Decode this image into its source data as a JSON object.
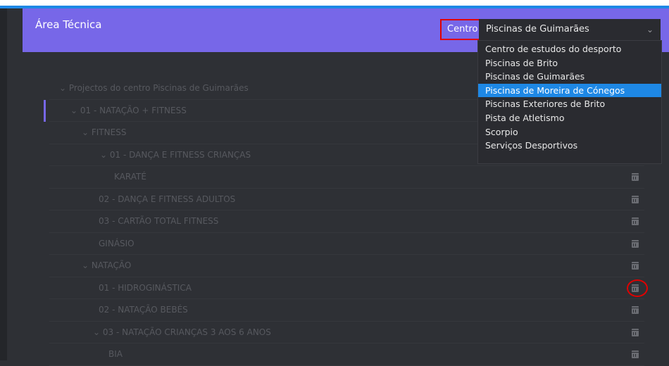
{
  "header": {
    "title": "Área Técnica",
    "centro_label": "Centro",
    "select_value": "Piscinas de Guimarães"
  },
  "dropdown": {
    "options": [
      "Centro de estudos do desporto",
      "Piscinas de Brito",
      "Piscinas de Guimarães",
      "Piscinas de Moreira de Cónegos",
      "Piscinas Exteriores de Brito",
      "Pista de Atletismo",
      "Scorpio",
      "Serviços Desportivos"
    ],
    "highlighted": "Piscinas de Moreira de Cónegos"
  },
  "tree": {
    "rows": [
      {
        "label": "⌄ Projectos do centro Piscinas de Guimarães",
        "calendar": false
      },
      {
        "label": "⌄ 01 - NATAÇÃO + FITNESS",
        "calendar": false
      },
      {
        "label": "⌄ FITNESS",
        "calendar": false
      },
      {
        "label": "⌄ 01 - DANÇA E FITNESS CRIANÇAS",
        "calendar": false
      },
      {
        "label": "KARATÉ",
        "calendar": true
      },
      {
        "label": "02 - DANÇA E FITNESS ADULTOS",
        "calendar": true
      },
      {
        "label": "03 - CARTÃO TOTAL FITNESS",
        "calendar": true
      },
      {
        "label": "GINÁSIO",
        "calendar": true
      },
      {
        "label": "⌄ NATAÇÃO",
        "calendar": true
      },
      {
        "label": "01 - HIDROGINÁSTICA",
        "calendar": true
      },
      {
        "label": "02 - NATAÇÃO BEBÉS",
        "calendar": true
      },
      {
        "label": "⌄ 03 - NATAÇÃO CRIANÇAS 3 AOS 6 ANOS",
        "calendar": true
      },
      {
        "label": "BIA",
        "calendar": true
      }
    ]
  },
  "icons": {
    "calendar": "calendar-icon",
    "chevron": "chevron-down-icon"
  }
}
